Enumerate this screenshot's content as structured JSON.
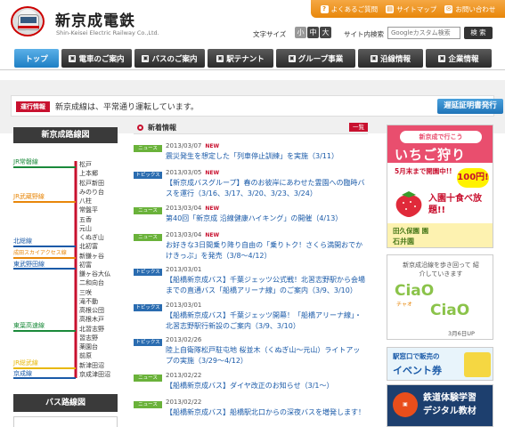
{
  "header": {
    "logo_title": "新京成電鉄",
    "logo_subtitle": "Shin-Keisei Electric Railway Co.,Ltd.",
    "top_links": [
      {
        "label": "よくあるご質問",
        "icon": "question-icon"
      },
      {
        "label": "サイトマップ",
        "icon": "sitemap-icon"
      },
      {
        "label": "お問い合わせ",
        "icon": "mail-icon"
      }
    ],
    "font_size_label": "文字サイズ",
    "font_sizes": [
      "小",
      "中",
      "大"
    ],
    "search_label": "サイト内検索",
    "search_placeholder": "Googleカスタム検索",
    "search_button": "検 索"
  },
  "nav": {
    "items": [
      {
        "label": "トップ",
        "active": true
      },
      {
        "label": "電車のご案内",
        "active": false
      },
      {
        "label": "バスのご案内",
        "active": false
      },
      {
        "label": "駅テナント",
        "active": false
      },
      {
        "label": "グループ事業",
        "active": false
      },
      {
        "label": "沿線情報",
        "active": false
      },
      {
        "label": "企業情報",
        "active": false
      }
    ]
  },
  "status": {
    "badge": "運行情報",
    "text": "新京成線は、平常通り運転しています。",
    "certificate_button": "遅延証明書発行"
  },
  "rail_map": {
    "title": "新京成路線図",
    "line_labels": [
      {
        "label": "JR常磐線",
        "color": "#1a8a3a"
      },
      {
        "label": "JR武蔵野線",
        "color": "#e8870a"
      },
      {
        "label": "北総線",
        "color": "#1a5aa8"
      },
      {
        "label": "成田スカイアクセス線",
        "color": "#e8870a"
      },
      {
        "label": "東武野田線",
        "color": "#1a5aa8"
      },
      {
        "label": "東葉高速線",
        "color": "#1a8a3a"
      },
      {
        "label": "JR総武線",
        "color": "#e8b80a"
      },
      {
        "label": "京成線",
        "color": "#1a5aa8"
      }
    ],
    "stations": [
      "松戸",
      "上本郷",
      "松戸新田",
      "みのり台",
      "八柱",
      "常盤平",
      "五香",
      "元山",
      "くぬぎ山",
      "北初富",
      "新鎌ヶ谷",
      "初富",
      "鎌ヶ谷大仏",
      "二和向台",
      "三咲",
      "滝不動",
      "高根公団",
      "高根木戸",
      "北習志野",
      "習志野",
      "薬園台",
      "前原",
      "新津田沼",
      "京成津田沼"
    ],
    "line_color": "#c8102e"
  },
  "bus_map": {
    "title": "バス路線図"
  },
  "news": {
    "title": "新着情報",
    "all_button": "一覧",
    "items": [
      {
        "tag": "ニュース",
        "type": "news",
        "date": "2013/03/07",
        "is_new": true,
        "text": "震災発生を想定した「列車停止訓練」を実施（3/11）"
      },
      {
        "tag": "トピックス",
        "type": "topics",
        "date": "2013/03/05",
        "is_new": true,
        "text": "【新京成バスグループ】春のお彼岸にあわせた霊園への臨時バスを運行（3/16、3/17、3/20、3/23、3/24）"
      },
      {
        "tag": "ニュース",
        "type": "news",
        "date": "2013/03/04",
        "is_new": true,
        "text": "第40回「新京成 沿線健康ハイキング」の開催（4/13）"
      },
      {
        "tag": "ニュース",
        "type": "news",
        "date": "2013/03/04",
        "is_new": true,
        "text": "お好きな3日間乗り降り自由の「乗りトク！さくら満開おでかけきっぷ」を発売（3/8〜4/12）"
      },
      {
        "tag": "トピックス",
        "type": "topics",
        "date": "2013/03/01",
        "is_new": false,
        "text": "【船橋新京成バス】千葉ジェッツ公式戦！北習志野駅から会場までの直通バス「船橋アリーナ線」のご案内（3/9、3/10）"
      },
      {
        "tag": "トピックス",
        "type": "topics",
        "date": "2013/03/01",
        "is_new": false,
        "text": "【船橋新京成バス】千葉ジェッツ開幕！「船橋アリーナ線」・北習志野駅行新設のご案内（3/9、3/10）"
      },
      {
        "tag": "トピックス",
        "type": "topics",
        "date": "2013/02/26",
        "is_new": false,
        "text": "陸上自衛隊松戸駐屯地 桜並木（くぬぎ山〜元山）ライトアップの実施（3/29〜4/12）"
      },
      {
        "tag": "ニュース",
        "type": "news",
        "date": "2013/02/22",
        "is_new": false,
        "text": "【船橋新京成バス】ダイヤ改正のお知らせ（3/1〜）"
      },
      {
        "tag": "ニュース",
        "type": "news",
        "date": "2013/02/22",
        "is_new": false,
        "text": "【船橋新京成バス】船橋駅北口からの深夜バスを増発します！"
      }
    ]
  },
  "banners": {
    "strawberry": {
      "top": "新京成で行こう",
      "big": "いちご狩り",
      "sub": "5月末まで開園中!!",
      "price": "100円!",
      "eat": "入園十食べ放題!!",
      "farm1": "田久保園 園",
      "farm2": "石井園"
    },
    "ciao": {
      "text": "新京成沿線を歩き回って 紹介していきます",
      "c1": "CiaO",
      "c2": "CiaO",
      "chao": "チャオ",
      "date": "3月6日UP"
    },
    "events": {
      "l1": "駅窓口で販売の",
      "l2": "イベント券"
    },
    "digital": {
      "l1": "鉄道体験学習",
      "l2": "デジタル教材"
    }
  }
}
